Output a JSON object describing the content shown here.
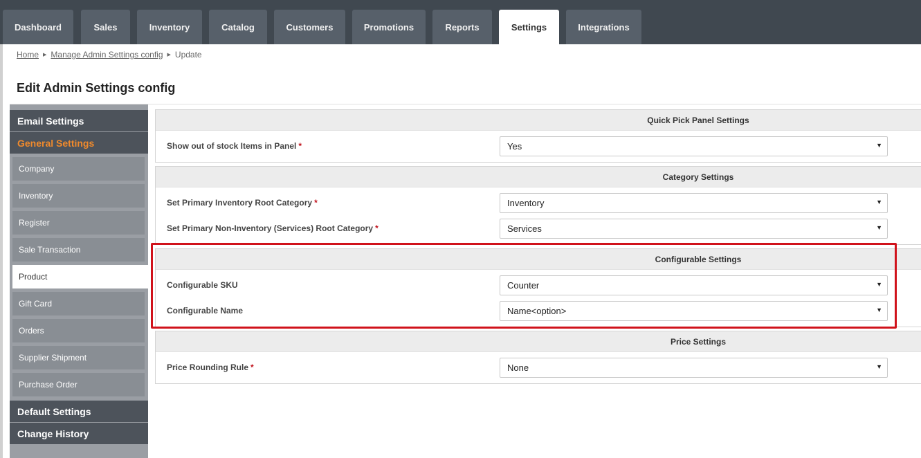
{
  "nav": {
    "tabs": [
      {
        "label": "Dashboard"
      },
      {
        "label": "Sales"
      },
      {
        "label": "Inventory"
      },
      {
        "label": "Catalog"
      },
      {
        "label": "Customers"
      },
      {
        "label": "Promotions"
      },
      {
        "label": "Reports"
      },
      {
        "label": "Settings",
        "active": true
      },
      {
        "label": "Integrations"
      }
    ]
  },
  "breadcrumb": {
    "home": "Home",
    "parent": "Manage Admin Settings config",
    "current": "Update"
  },
  "page_title": "Edit Admin Settings config",
  "sidebar": {
    "email": "Email Settings",
    "general": "General Settings",
    "items": [
      "Company",
      "Inventory",
      "Register",
      "Sale Transaction",
      "Product",
      "Gift Card",
      "Orders",
      "Supplier Shipment",
      "Purchase Order"
    ],
    "active_item": "Product",
    "default": "Default Settings",
    "history": "Change History"
  },
  "panels": {
    "quick_pick": {
      "title": "Quick Pick Panel Settings",
      "show_out_of_stock_label": "Show out of stock Items in Panel",
      "show_out_of_stock_value": "Yes"
    },
    "category": {
      "title": "Category Settings",
      "primary_inventory_label": "Set Primary Inventory Root Category",
      "primary_inventory_value": "Inventory",
      "primary_noninventory_label": "Set Primary Non-Inventory (Services) Root Category",
      "primary_noninventory_value": "Services"
    },
    "configurable": {
      "title": "Configurable Settings",
      "sku_label": "Configurable SKU",
      "sku_value": "Counter",
      "name_label": "Configurable Name",
      "name_value": "Name<option>"
    },
    "price": {
      "title": "Price Settings",
      "rounding_label": "Price Rounding Rule",
      "rounding_value": "None"
    }
  },
  "required_mark": "*",
  "colors": {
    "nav_bg": "#404850",
    "tab_bg": "#57606a",
    "accent_orange": "#f08a2c",
    "highlight_red": "#d0121b",
    "required_red": "#c0141e"
  }
}
